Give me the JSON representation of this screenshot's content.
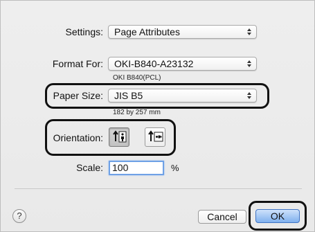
{
  "settings": {
    "label": "Settings:",
    "value": "Page Attributes"
  },
  "format_for": {
    "label": "Format For:",
    "value": "OKI-B840-A23132",
    "subtitle": "OKI B840(PCL)"
  },
  "paper_size": {
    "label": "Paper Size:",
    "value": "JIS B5",
    "subtitle": "182 by 257 mm"
  },
  "orientation": {
    "label": "Orientation:",
    "selected": "portrait"
  },
  "scale": {
    "label": "Scale:",
    "value": "100",
    "unit": "%"
  },
  "buttons": {
    "help": "?",
    "cancel": "Cancel",
    "ok": "OK"
  },
  "colors": {
    "highlight_outline": "#111111",
    "default_button": "#7fb0ee",
    "field_focus": "#6fa1e6"
  }
}
